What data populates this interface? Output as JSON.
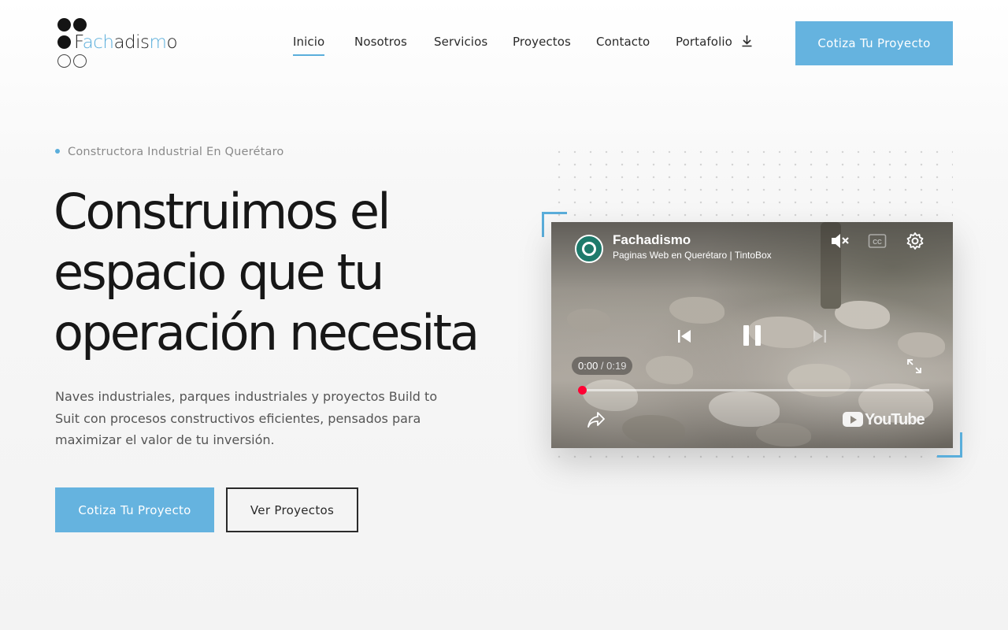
{
  "brand": {
    "logo_prefix": "F",
    "logo_accent": "ach",
    "logo_middle": "adis",
    "logo_accent2": "m",
    "logo_suffix": "o",
    "accent_color": "#5aaedb",
    "button_color": "#65b3df"
  },
  "nav": {
    "items": [
      {
        "label": "Inicio",
        "active": true
      },
      {
        "label": "Nosotros"
      },
      {
        "label": "Servicios"
      },
      {
        "label": "Proyectos"
      },
      {
        "label": "Contacto"
      },
      {
        "label": "Portafolio",
        "icon": "download-icon"
      }
    ],
    "cta_label": "Cotiza Tu Proyecto"
  },
  "hero": {
    "eyebrow": "Constructora Industrial En Querétaro",
    "title_lines": [
      "Construimos el",
      "espacio que tu",
      "operación necesita"
    ],
    "description": "Naves industriales, parques industriales y proyectos Build to Suit con procesos constructivos eficientes, pensados para maximizar el valor de tu inversión.",
    "primary_button": "Cotiza Tu Proyecto",
    "secondary_button": "Ver Proyectos"
  },
  "video": {
    "channel_name": "Fachadismo",
    "video_title": "Paginas Web en Querétaro | TintoBox",
    "current_time": "0:00",
    "separator": " / ",
    "duration": "0:19",
    "progress": 0.01,
    "platform_label": "YouTube",
    "muted": true,
    "state": "playing"
  }
}
